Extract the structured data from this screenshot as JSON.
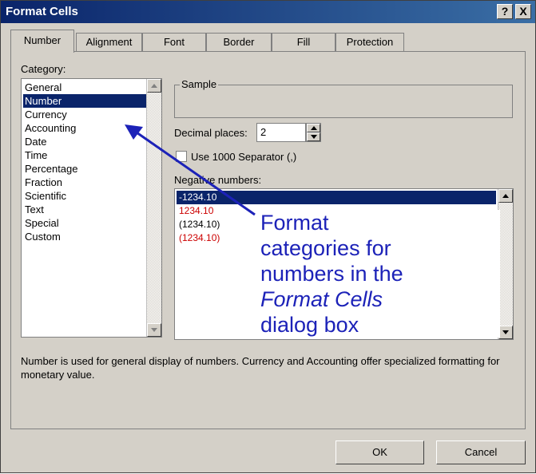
{
  "window": {
    "title": "Format Cells",
    "help_label": "?",
    "close_label": "X"
  },
  "tabs": [
    {
      "label": "Number",
      "active": true
    },
    {
      "label": "Alignment"
    },
    {
      "label": "Font"
    },
    {
      "label": "Border"
    },
    {
      "label": "Fill"
    },
    {
      "label": "Protection"
    }
  ],
  "category": {
    "label": "Category:",
    "items": [
      "General",
      "Number",
      "Currency",
      "Accounting",
      "Date",
      "Time",
      "Percentage",
      "Fraction",
      "Scientific",
      "Text",
      "Special",
      "Custom"
    ],
    "selected": "Number"
  },
  "sample": {
    "label": "Sample"
  },
  "decimal_places": {
    "label": "Decimal places:",
    "value": "2"
  },
  "separator": {
    "label": "Use 1000 Separator (,)",
    "checked": false
  },
  "negative_numbers": {
    "label": "Negative numbers:",
    "items": [
      {
        "text": "-1234.10",
        "color": "#000000",
        "selected": true
      },
      {
        "text": "1234.10",
        "color": "#cc0000"
      },
      {
        "text": "(1234.10)",
        "color": "#000000"
      },
      {
        "text": "(1234.10)",
        "color": "#cc0000"
      }
    ]
  },
  "annotation": {
    "line1": "Format",
    "line2": "categories for",
    "line3": "numbers in the",
    "line4": "Format Cells",
    "line5": "dialog box",
    "color": "#1c22b8"
  },
  "description": "Number is used for general display of numbers.  Currency and Accounting offer specialized formatting for monetary value.",
  "buttons": {
    "ok": "OK",
    "cancel": "Cancel"
  }
}
